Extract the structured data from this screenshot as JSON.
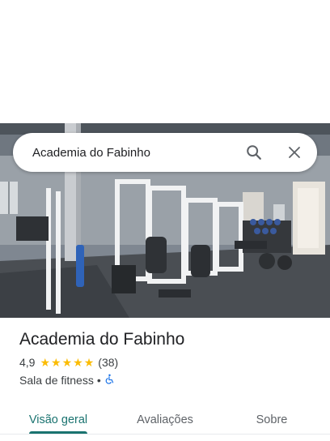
{
  "search": {
    "query": "Academia do Fabinho",
    "search_icon": "search-icon",
    "close_icon": "close-icon"
  },
  "place": {
    "name": "Academia do Fabinho",
    "rating": "4,9",
    "stars": 5,
    "review_count": "(38)",
    "category": "Sala de fitness",
    "separator": "•",
    "accessibility_icon": "wheelchair-icon"
  },
  "tabs": [
    {
      "label": "Visão geral",
      "active": true
    },
    {
      "label": "Avaliações",
      "active": false
    },
    {
      "label": "Sobre",
      "active": false
    }
  ],
  "colors": {
    "accent": "#1a7370",
    "star": "#fbbc04",
    "accessibility": "#1a73e8"
  }
}
